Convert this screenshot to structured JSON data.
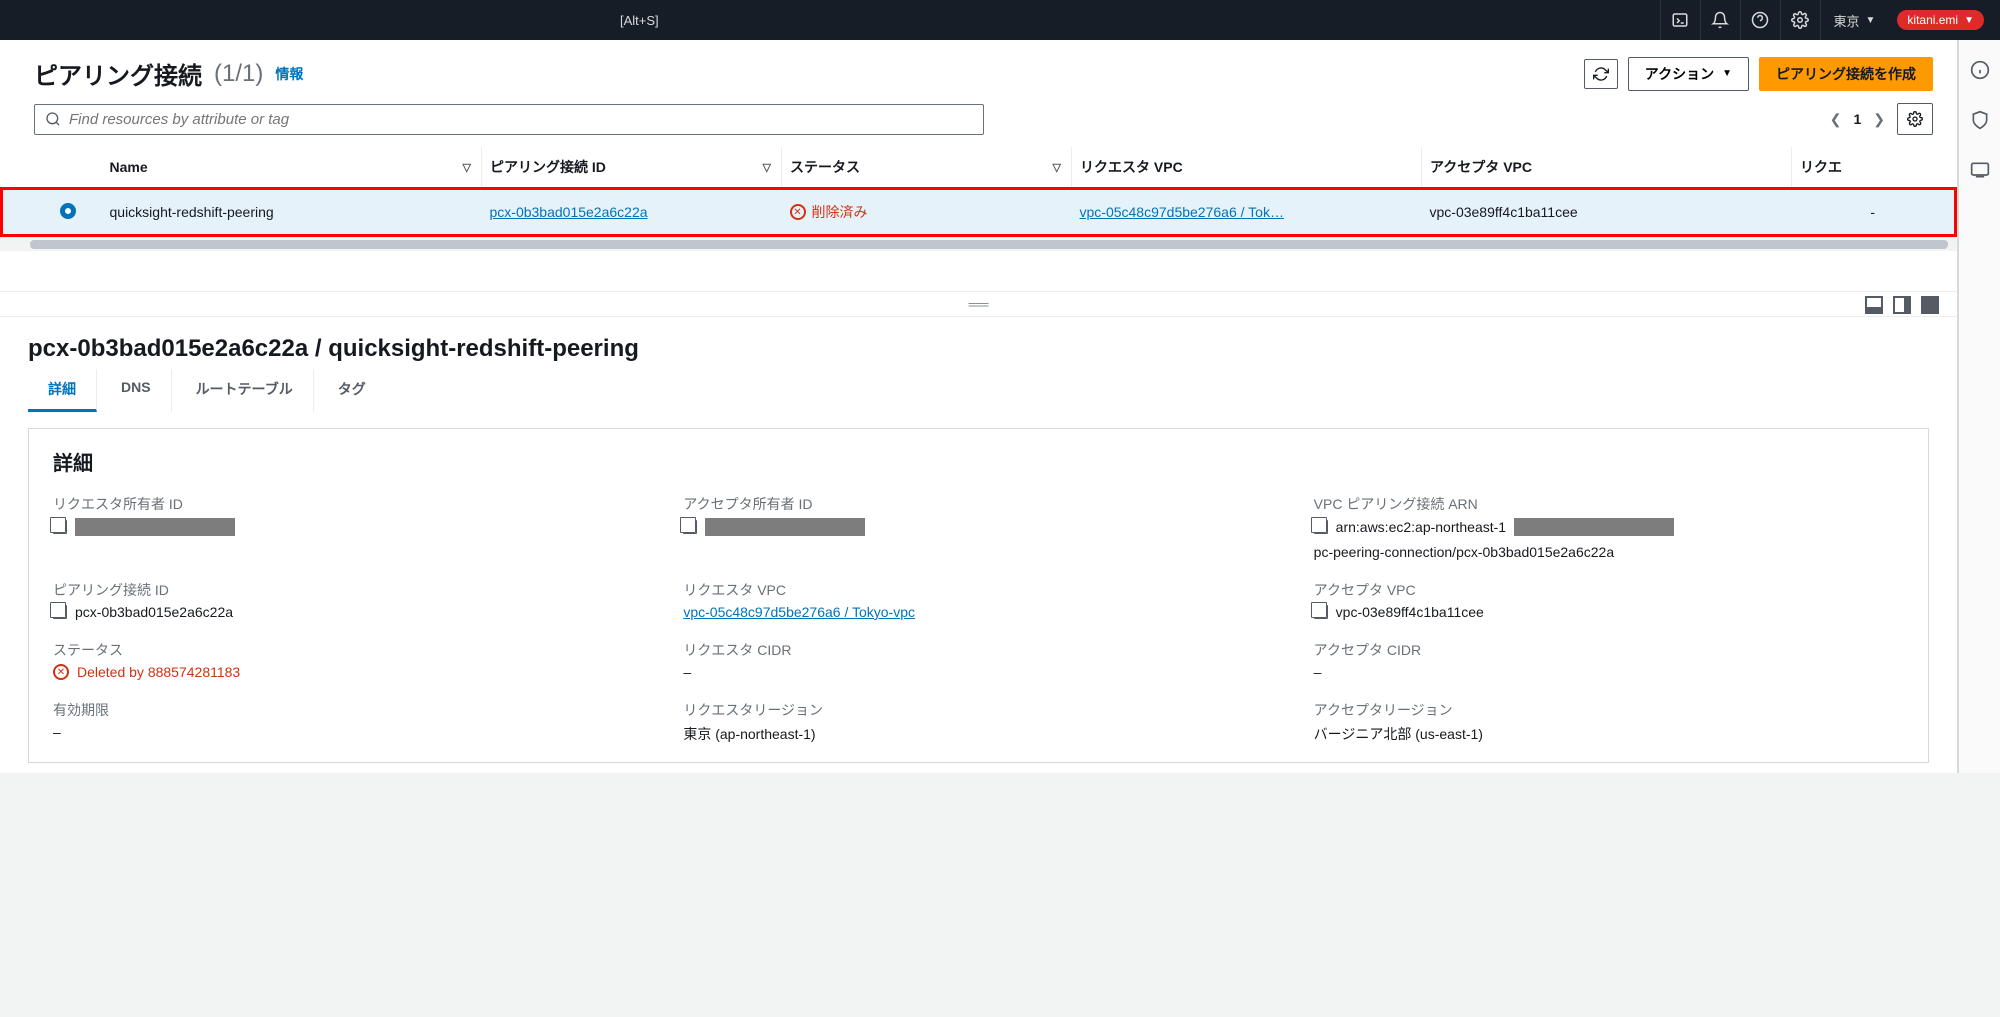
{
  "topnav": {
    "shortcut": "[Alt+S]",
    "region": "東京",
    "user": "kitani.emi"
  },
  "header": {
    "title": "ピアリング接続",
    "count": "(1/1)",
    "info": "情報",
    "refresh_label": "",
    "actions_label": "アクション",
    "create_label": "ピアリング接続を作成"
  },
  "filter": {
    "placeholder": "Find resources by attribute or tag",
    "page": "1"
  },
  "columns": {
    "name": "Name",
    "peering_id": "ピアリング接続 ID",
    "status": "ステータス",
    "requester_vpc": "リクエスタ VPC",
    "accepter_vpc": "アクセプタ VPC",
    "requester_extra": "リクエ"
  },
  "rows": [
    {
      "name": "quicksight-redshift-peering",
      "peering_id": "pcx-0b3bad015e2a6c22a",
      "status": "削除済み",
      "requester_vpc": "vpc-05c48c97d5be276a6 / Tok…",
      "accepter_vpc": "vpc-03e89ff4c1ba11cee",
      "requester_extra": "-"
    }
  ],
  "detail": {
    "title": "pcx-0b3bad015e2a6c22a / quicksight-redshift-peering",
    "tabs": {
      "detail": "詳細",
      "dns": "DNS",
      "route": "ルートテーブル",
      "tag": "タグ"
    },
    "panel_title": "詳細",
    "fields": {
      "requester_owner_label": "リクエスタ所有者 ID",
      "accepter_owner_label": "アクセプタ所有者 ID",
      "arn_label": "VPC ピアリング接続 ARN",
      "arn_value_prefix": "arn:aws:ec2:ap-northeast-1",
      "arn_value_suffix": "pc-peering-connection/pcx-0b3bad015e2a6c22a",
      "peering_id_label": "ピアリング接続 ID",
      "peering_id_value": "pcx-0b3bad015e2a6c22a",
      "requester_vpc_label": "リクエスタ VPC",
      "requester_vpc_value": "vpc-05c48c97d5be276a6 / Tokyo-vpc",
      "accepter_vpc_label": "アクセプタ VPC",
      "accepter_vpc_value": "vpc-03e89ff4c1ba11cee",
      "status_label": "ステータス",
      "status_value": "Deleted by 888574281183",
      "requester_cidr_label": "リクエスタ CIDR",
      "requester_cidr_value": "–",
      "accepter_cidr_label": "アクセプタ CIDR",
      "accepter_cidr_value": "–",
      "expiry_label": "有効期限",
      "expiry_value": "–",
      "requester_region_label": "リクエスタリージョン",
      "requester_region_value": "東京 (ap-northeast-1)",
      "accepter_region_label": "アクセプタリージョン",
      "accepter_region_value": "バージニア北部 (us-east-1)"
    }
  }
}
